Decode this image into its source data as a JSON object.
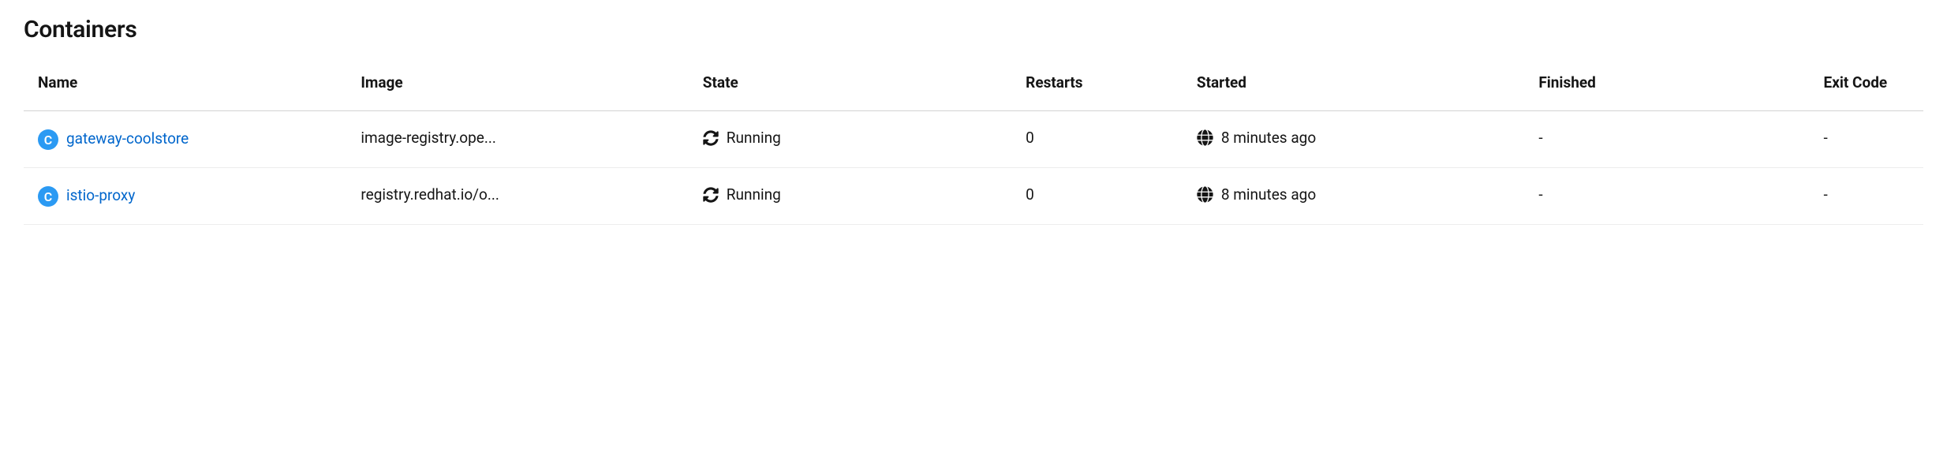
{
  "section": {
    "title": "Containers"
  },
  "table": {
    "headers": {
      "name": "Name",
      "image": "Image",
      "state": "State",
      "restarts": "Restarts",
      "started": "Started",
      "finished": "Finished",
      "exit_code": "Exit Code"
    },
    "badge_letter": "C",
    "rows": [
      {
        "name": "gateway-coolstore",
        "image": "image-registry.ope...",
        "state": "Running",
        "restarts": "0",
        "started": "8 minutes ago",
        "finished": "-",
        "exit_code": "-"
      },
      {
        "name": "istio-proxy",
        "image": "registry.redhat.io/o...",
        "state": "Running",
        "restarts": "0",
        "started": "8 minutes ago",
        "finished": "-",
        "exit_code": "-"
      }
    ]
  }
}
